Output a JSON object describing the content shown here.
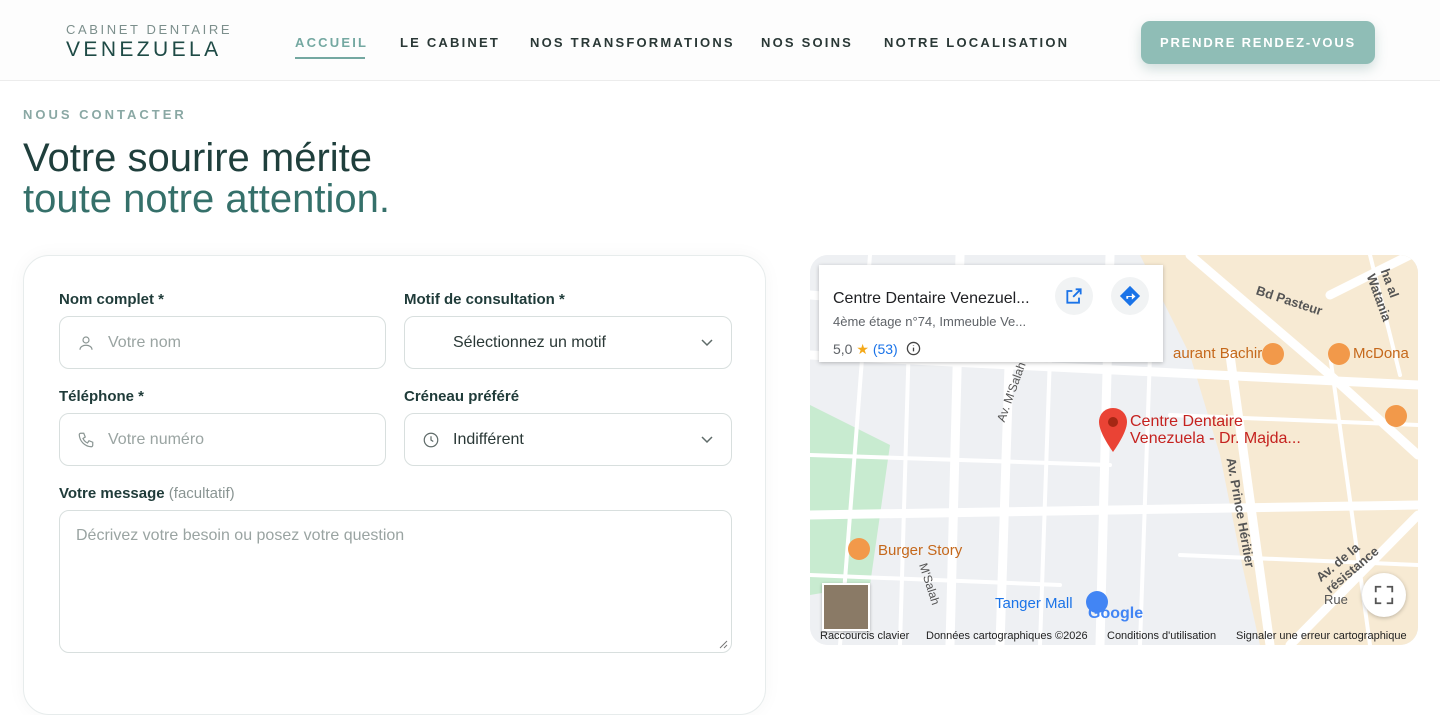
{
  "header": {
    "logo_top": "CABINET DENTAIRE",
    "logo_main": "VENEZUELA",
    "nav": [
      "ACCUEIL",
      "LE CABINET",
      "NOS TRANSFORMATIONS",
      "NOS SOINS",
      "NOTRE LOCALISATION"
    ],
    "cta": "PRENDRE RENDEZ-VOUS",
    "accent": "#8fbdb6"
  },
  "hero": {
    "eyebrow": "NOUS CONTACTER",
    "title_line1": "Votre sourire mérite",
    "title_line2": "toute notre attention."
  },
  "form": {
    "name_label": "Nom complet *",
    "name_placeholder": "Votre nom",
    "name_icon": "user-icon",
    "reason_label": "Motif de consultation *",
    "reason_value": "Sélectionnez un motif",
    "phone_label": "Téléphone *",
    "phone_placeholder": "Votre numéro",
    "phone_icon": "phone-icon",
    "slot_label": "Créneau préféré",
    "slot_value": "Indifférent",
    "slot_icon": "clock-icon",
    "message_label": "Votre message",
    "message_optional": "(facultatif)",
    "message_placeholder": "Décrivez votre besoin ou posez votre question"
  },
  "map": {
    "place_title": "Centre Dentaire Venezuel...",
    "place_address": "4ème étage n°74, Immeuble Ve...",
    "rating": "5,0",
    "review_count": "(53)",
    "pin_label_1": "Centre Dentaire",
    "pin_label_2": "Venezuela - Dr. Majda...",
    "streets": [
      "Bd Pasteur",
      "Av. M'Salah",
      "Av. Prince Héritier",
      "Av. de la résistance",
      "M'Salah",
      "Rue",
      "ha al Watania"
    ],
    "pois": [
      "aurant Bachir",
      "McDona",
      "Burger Story",
      "Tanger Mall"
    ],
    "footer": [
      "Raccourcis clavier",
      "Données cartographiques ©2026",
      "Conditions d'utilisation",
      "Signaler une erreur cartographique"
    ],
    "brand": "Google"
  }
}
